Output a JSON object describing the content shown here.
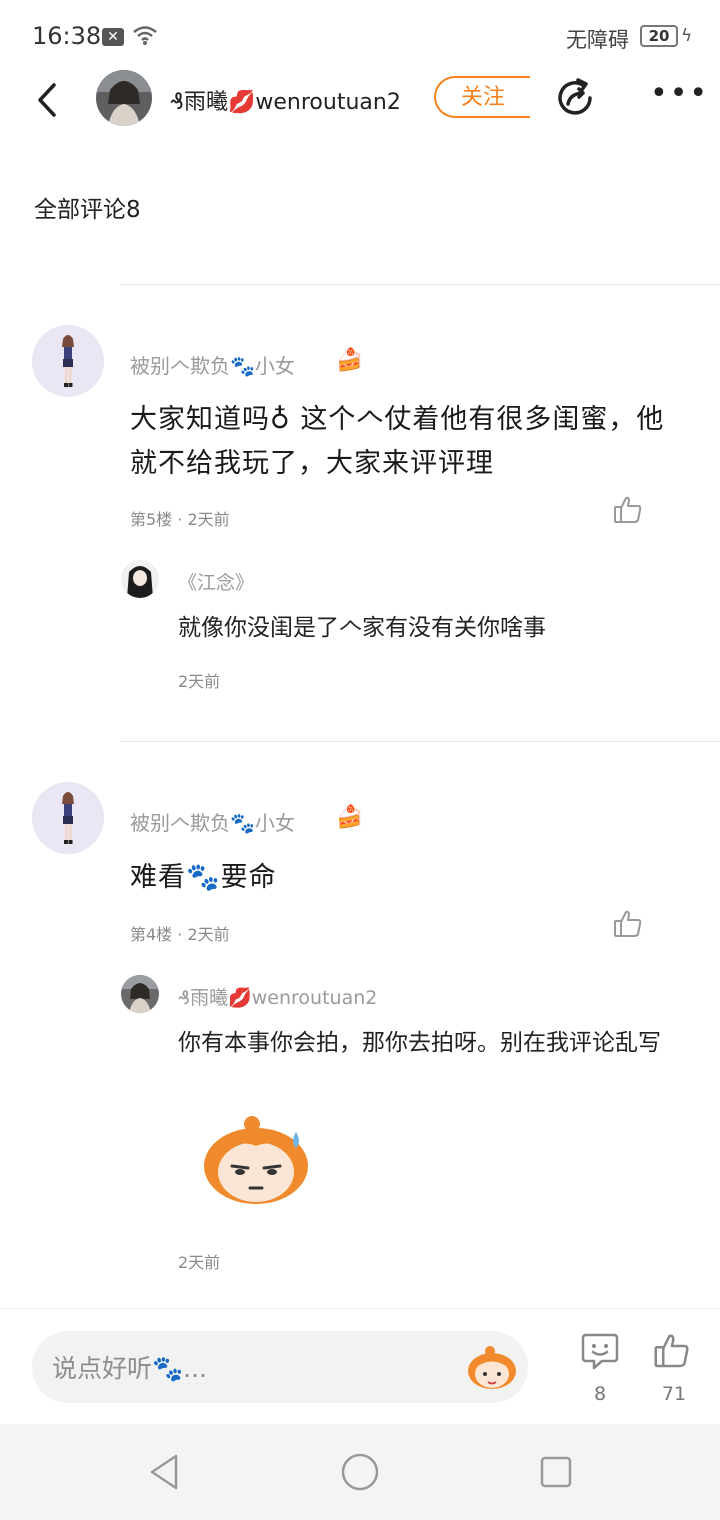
{
  "status_bar": {
    "time": "16:38",
    "accessibility": "无障碍",
    "battery": "20"
  },
  "header": {
    "author_name": "₰雨曦💋wenroutuan2",
    "follow_label": "关注",
    "more_label": "•••"
  },
  "comments_title": "全部评论8",
  "comments": [
    {
      "user": "被别𠆢欺负🐾小女",
      "badge": "🍰",
      "text": "大家知道吗♁ 这个𠆢仗着他有很多闺蜜，他就不给我玩了，大家来评评理",
      "meta": "第5楼 · 2天前",
      "reply": {
        "user": "《江念》",
        "text": "就像你没闺是了𠆢家有没有关你啥事",
        "time": "2天前"
      }
    },
    {
      "user": "被别𠆢欺负🐾小女",
      "badge": "🍰",
      "text": "难看🐾要命",
      "meta": "第4楼 · 2天前",
      "reply": {
        "user": "₰雨曦💋wenroutuan2",
        "text": "你有本事你会拍，那你去拍呀。别在我评论乱写",
        "time": "2天前"
      }
    }
  ],
  "bottom_bar": {
    "input_placeholder": "说点好听🐾...",
    "comment_count": "8",
    "like_count": "71"
  },
  "colors": {
    "accent": "#f5821f",
    "muted_text": "#9a9a9a"
  },
  "icons": [
    "back-arrow-icon",
    "share-icon",
    "more-icon",
    "like-icon",
    "comment-icon",
    "emoji-sticker-icon",
    "nav-back-icon",
    "nav-home-icon",
    "nav-recent-icon"
  ]
}
